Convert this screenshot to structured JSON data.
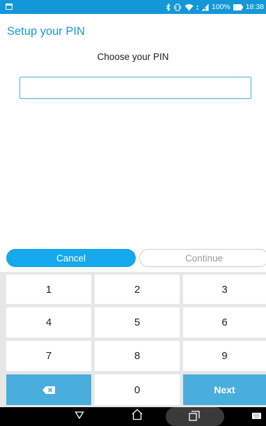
{
  "status_bar": {
    "battery_percent": "100%",
    "time": "18:38",
    "icons": [
      "app-notification-icon",
      "bluetooth-icon",
      "vibrate-icon",
      "wifi-icon",
      "battery-charging-icon"
    ]
  },
  "header": {
    "title": "Setup your PIN"
  },
  "main": {
    "prompt": "Choose your PIN",
    "pin_input": {
      "value": "",
      "placeholder": ""
    }
  },
  "actions": {
    "cancel_label": "Cancel",
    "continue_label": "Continue"
  },
  "keypad": {
    "keys": [
      "1",
      "2",
      "3",
      "4",
      "5",
      "6",
      "7",
      "8",
      "9",
      "0"
    ],
    "delete_icon": "backspace-icon",
    "next_label": "Next"
  },
  "nav_bar": {
    "icons": [
      "back-icon",
      "home-icon",
      "recents-icon",
      "keyboard-icon"
    ]
  },
  "colors": {
    "accent": "#15a8ea",
    "status_bar": "#1497d8",
    "title": "#1a98d6",
    "key_blue": "#4aaedc",
    "keypad_bg": "#e7e7e7"
  }
}
